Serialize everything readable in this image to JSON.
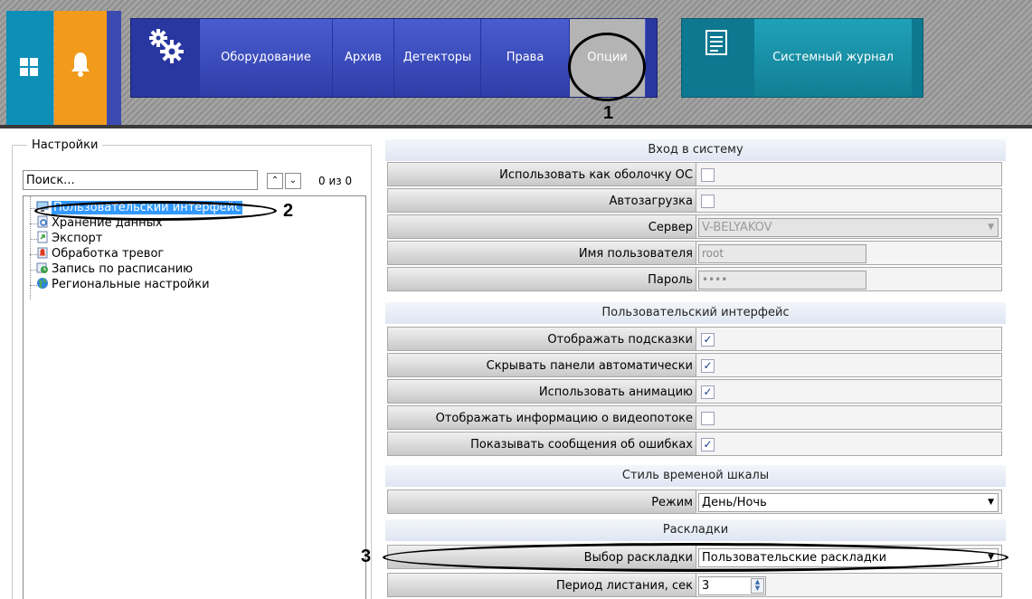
{
  "topbar": {
    "nav_items": [
      {
        "label": "Оборудование"
      },
      {
        "label": "Архив"
      },
      {
        "label": "Детекторы"
      },
      {
        "label": "Права"
      },
      {
        "label": "Опции"
      }
    ],
    "log_label": "Системный журнал"
  },
  "annotations": {
    "one": "1",
    "two": "2",
    "three": "3"
  },
  "left": {
    "group_title": "Настройки",
    "search_value": "Поиск...",
    "search_count": "0 из 0",
    "tree": [
      {
        "label": "Пользовательский интерфейс",
        "icon": "monitor-icon",
        "selected": true
      },
      {
        "label": "Хранение данных",
        "icon": "storage-icon"
      },
      {
        "label": "Экспорт",
        "icon": "export-icon"
      },
      {
        "label": "Обработка тревог",
        "icon": "alarm-icon"
      },
      {
        "label": "Запись по расписанию",
        "icon": "schedule-icon"
      },
      {
        "label": "Региональные настройки",
        "icon": "globe-icon"
      }
    ]
  },
  "right": {
    "sec_login": "Вход в систему",
    "use_as_shell": "Использовать как оболочку ОС",
    "autostart": "Автозагрузка",
    "server_label": "Сервер",
    "server_value": "V-BELYAKOV",
    "username_label": "Имя пользователя",
    "username_value": "root",
    "password_label": "Пароль",
    "password_value": "••••",
    "sec_ui": "Пользовательский интерфейс",
    "show_hints": "Отображать подсказки",
    "hide_panels": "Скрывать панели автоматически",
    "use_animation": "Использовать анимацию",
    "show_stream_info": "Отображать информацию о видеопотоке",
    "show_errors": "Показывать сообщения об ошибках",
    "sec_timeline": "Стиль временой шкалы",
    "mode_label": "Режим",
    "mode_value": "День/Ночь",
    "sec_layouts": "Раскладки",
    "layout_choice_label": "Выбор раскладки",
    "layout_choice_value": "Пользовательские раскладки",
    "period_label": "Период листания, сек",
    "period_value": "3",
    "check_mark": "✓"
  }
}
